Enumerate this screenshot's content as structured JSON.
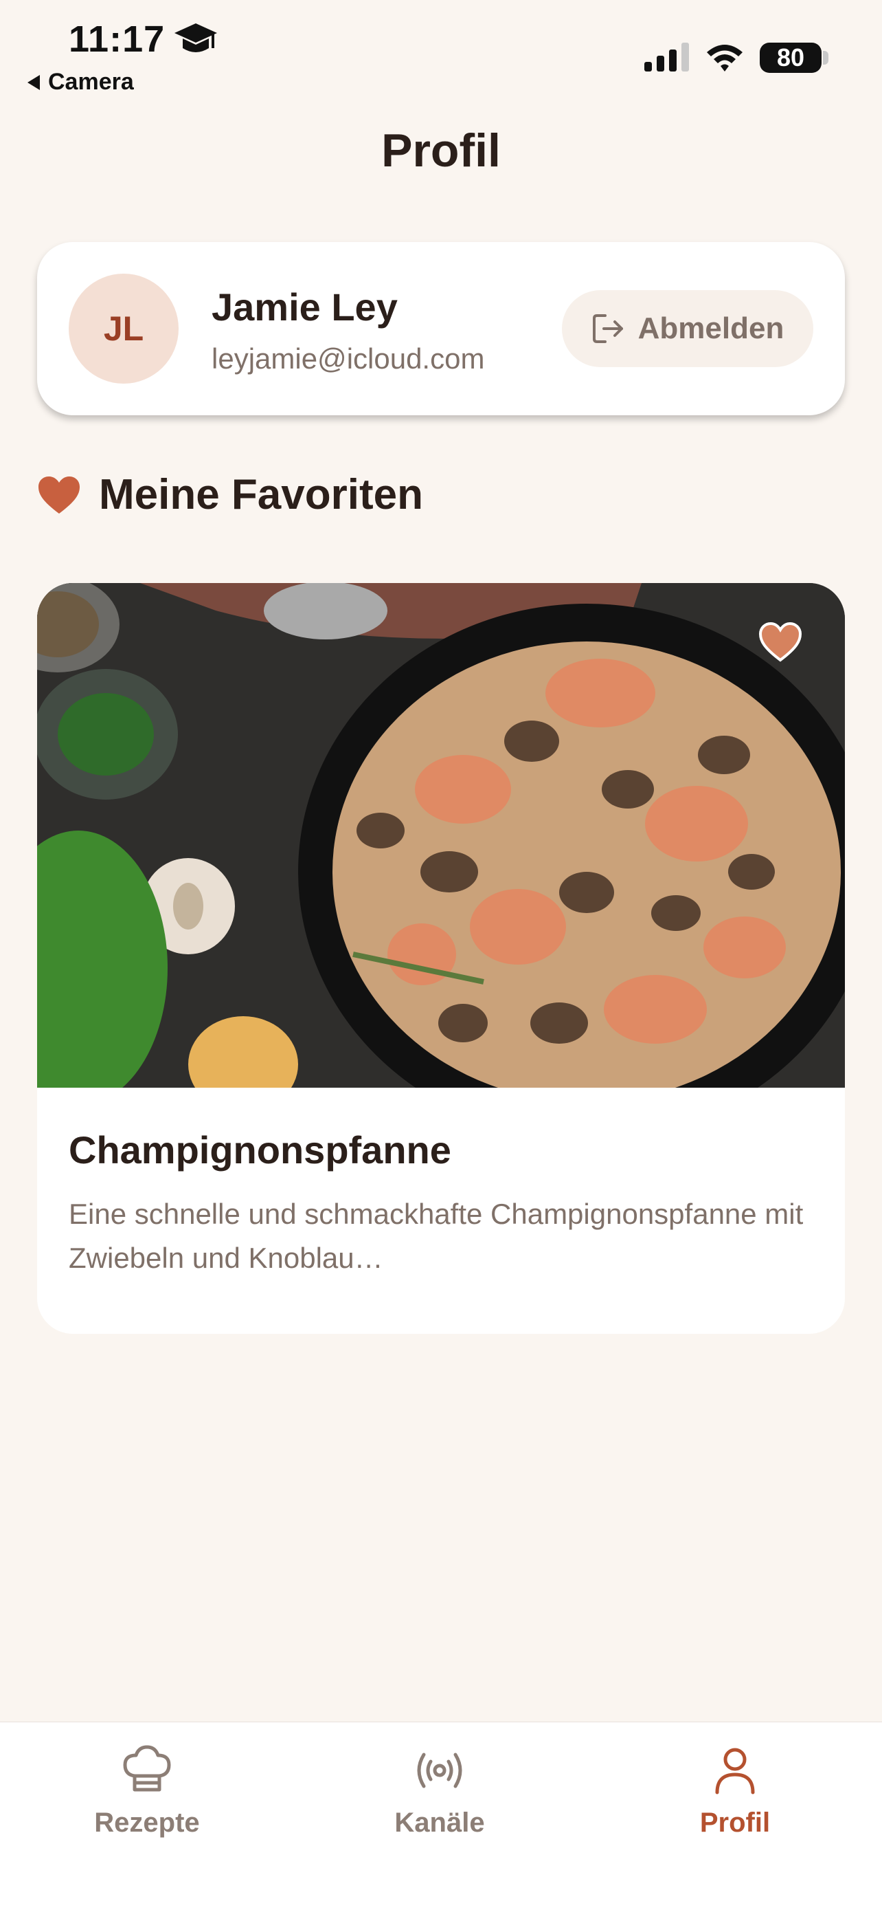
{
  "status_bar": {
    "time": "11:17",
    "back_label": "Camera",
    "battery": "80"
  },
  "page": {
    "title": "Profil"
  },
  "profile": {
    "initials": "JL",
    "name": "Jamie Ley",
    "email": "leyjamie@icloud.com",
    "logout_label": "Abmelden"
  },
  "favorites": {
    "heading": "Meine Favoriten",
    "items": [
      {
        "title": "Champignonspfanne",
        "description": "Eine schnelle und schmackhafte Champignonspfanne mit Zwiebeln und Knoblau…",
        "is_favorite": true
      }
    ]
  },
  "tabs": [
    {
      "label": "Rezepte",
      "icon": "chef-hat-icon",
      "active": false
    },
    {
      "label": "Kanäle",
      "icon": "broadcast-icon",
      "active": false
    },
    {
      "label": "Profil",
      "icon": "person-icon",
      "active": true
    }
  ],
  "colors": {
    "background": "#faf5f0",
    "accent": "#b4512f",
    "heart": "#c8603f",
    "avatar_bg": "#f4dfd4",
    "muted_text": "#7f7068"
  }
}
